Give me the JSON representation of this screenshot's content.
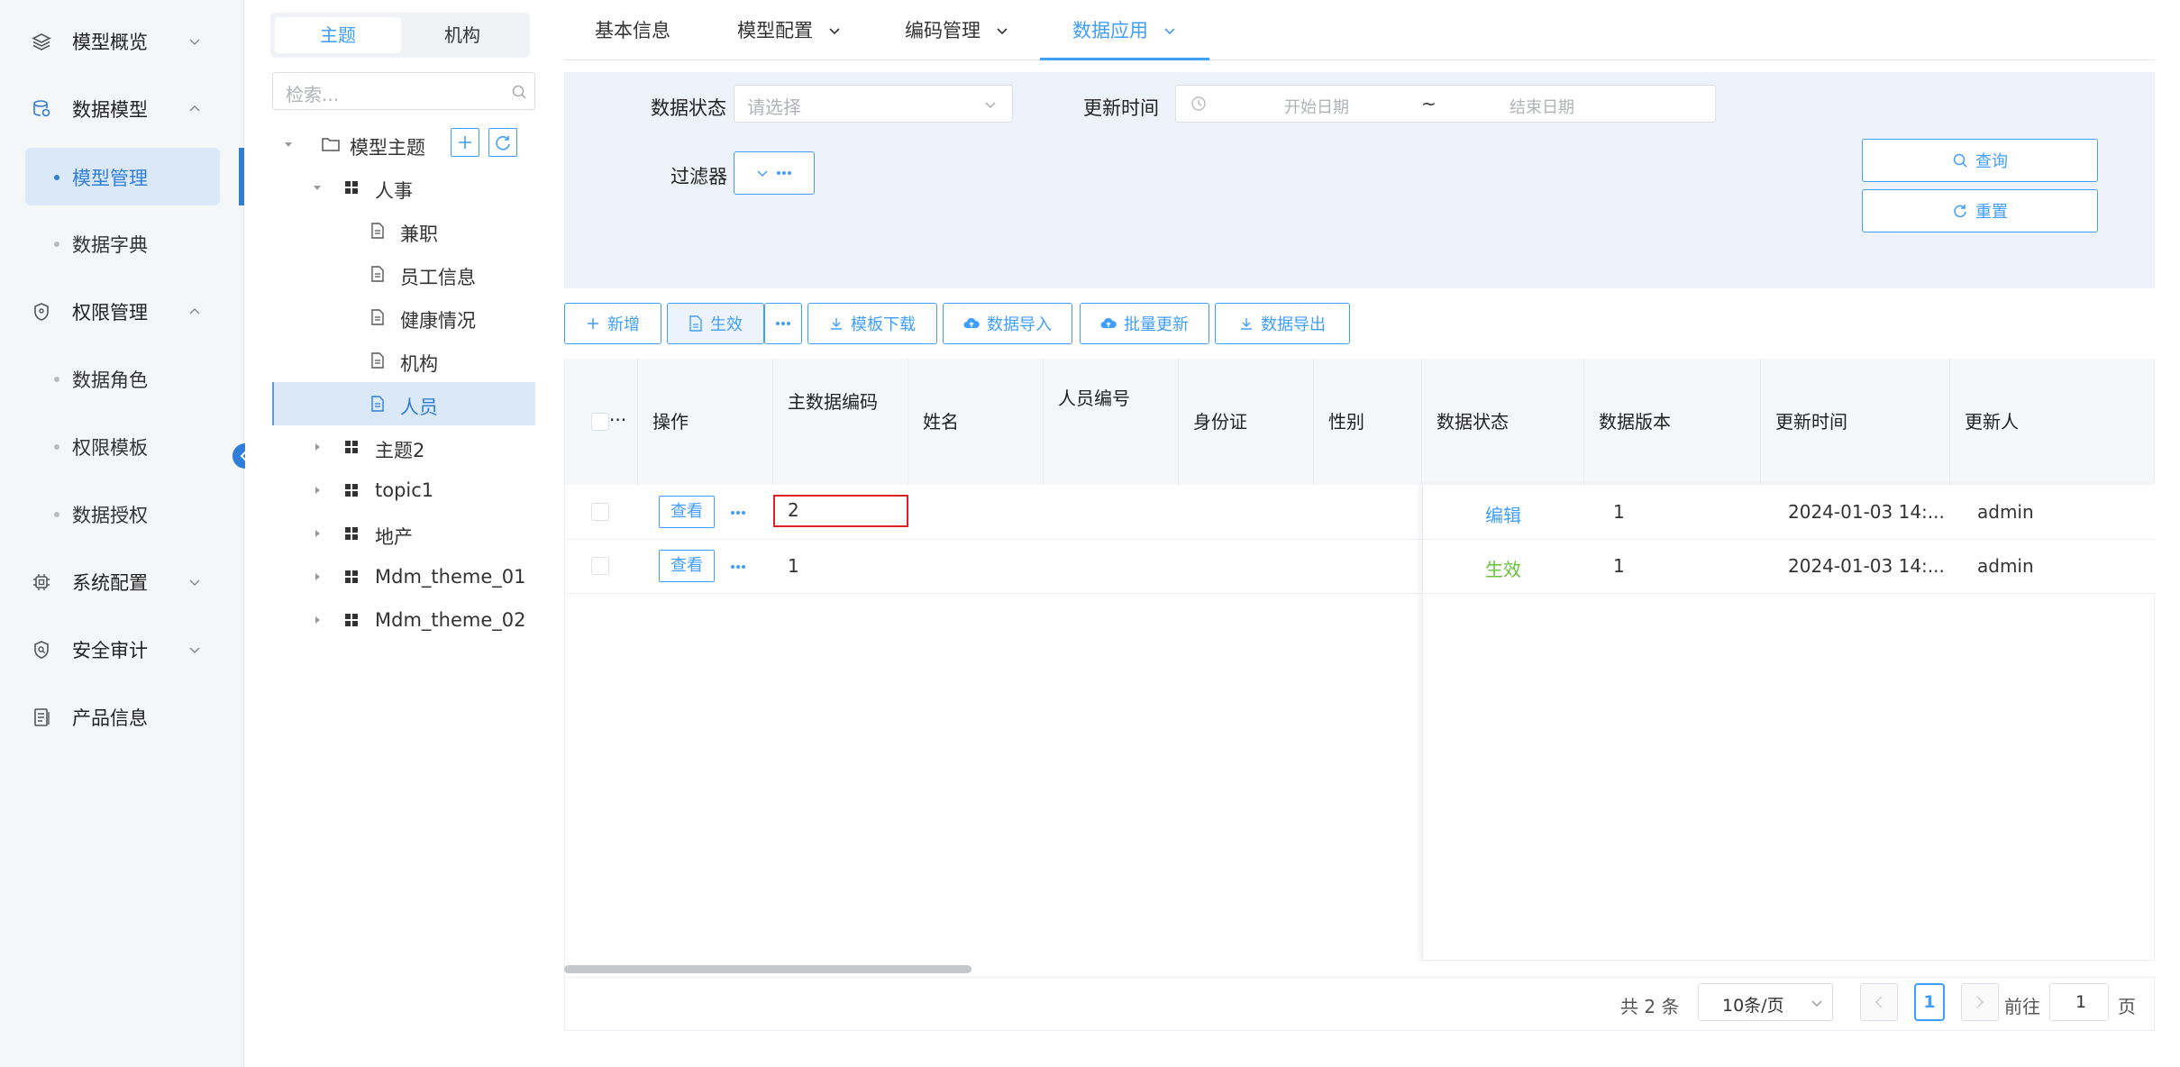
{
  "nav": {
    "items": [
      {
        "label": "模型概览"
      },
      {
        "label": "数据模型"
      },
      {
        "label": "权限管理"
      },
      {
        "label": "系统配置"
      },
      {
        "label": "安全审计"
      },
      {
        "label": "产品信息"
      }
    ],
    "sub": {
      "model_mgmt": "模型管理",
      "dictionary": "数据字典",
      "roles": "数据角色",
      "templates": "权限模板",
      "grant": "数据授权"
    }
  },
  "tree": {
    "tabs": [
      "主题",
      "机构"
    ],
    "search_placeholder": "检索...",
    "root": "模型主题",
    "nodes": [
      "人事",
      "兼职",
      "员工信息",
      "健康情况",
      "机构",
      "人员",
      "主题2",
      "topic1",
      "地产",
      "Mdm_theme_01",
      "Mdm_theme_02"
    ]
  },
  "main": {
    "tabs": [
      "基本信息",
      "模型配置",
      "编码管理",
      "数据应用"
    ],
    "filters": {
      "status_label": "数据状态",
      "status_placeholder": "请选择",
      "time_label": "更新时间",
      "start_placeholder": "开始日期",
      "separator": "~",
      "end_placeholder": "结束日期",
      "filter_label": "过滤器",
      "query": "查询",
      "reset": "重置"
    },
    "toolbar": {
      "add": "新增",
      "effect": "生效",
      "template_download": "模板下载",
      "import": "数据导入",
      "batch_update": "批量更新",
      "export": "数据导出"
    },
    "table": {
      "columns": [
        "操作",
        "主数据编码",
        "姓名",
        "人员编号",
        "身份证",
        "性别",
        "数据状态",
        "数据版本",
        "更新时间",
        "更新人"
      ],
      "rows": [
        {
          "view": "查看",
          "code": "2",
          "status": "编辑",
          "version": "1",
          "time": "2024-01-03 14:...",
          "user": "admin"
        },
        {
          "view": "查看",
          "code": "1",
          "status": "生效",
          "version": "1",
          "time": "2024-01-03 14:...",
          "user": "admin"
        }
      ]
    },
    "pager": {
      "total": "共 2 条",
      "size": "10条/页",
      "page": "1",
      "goto_label": "前往",
      "goto_value": "1",
      "page_suffix": "页"
    }
  },
  "colors": {
    "accent": "#409eff",
    "edit_status": "#409eff",
    "effect_status": "#67c23a",
    "highlight_box": "#e02020"
  }
}
